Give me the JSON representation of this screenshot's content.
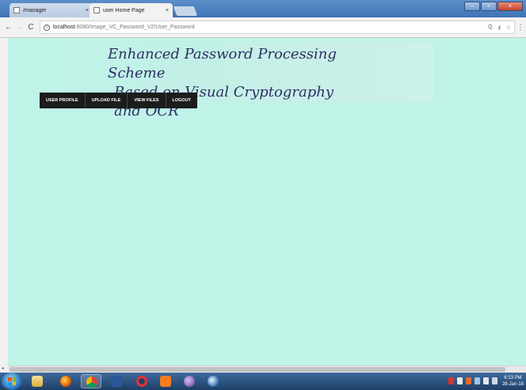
{
  "browser": {
    "tabs": [
      {
        "label": "/manager",
        "close": "×"
      },
      {
        "label": "user Home Page",
        "close": "×"
      }
    ],
    "window_buttons": {
      "minimize": "–",
      "maximize": "▫",
      "close": "×"
    },
    "nav": {
      "back": "←",
      "forward": "→",
      "reload": "C"
    },
    "address": {
      "host": "localhost",
      "path": ":8080/Image_VC_Password_V2/User_Password"
    },
    "toolbar_right": {
      "zoom": "Q",
      "key": "⚷",
      "star": "☆",
      "menu": "⋮"
    }
  },
  "page": {
    "title_line1": "Enhanced Password Processing Scheme",
    "title_line2": "Based on Visual Cryptography and OCR",
    "menu": [
      "USER PROFILE",
      "UPLOAD FILE",
      "VIEW FILES",
      "LOGOUT"
    ],
    "background_color": "#bff3e8",
    "menu_color": "#1c1c1c"
  },
  "taskbar": {
    "apps": [
      "folder-icon",
      "firefox-icon",
      "chrome-icon",
      "word-icon",
      "opera-icon",
      "g-app-icon",
      "eclipse-icon",
      "network-icon"
    ],
    "clock_time": "6:13 PM",
    "clock_date": "28-Jan-18"
  }
}
